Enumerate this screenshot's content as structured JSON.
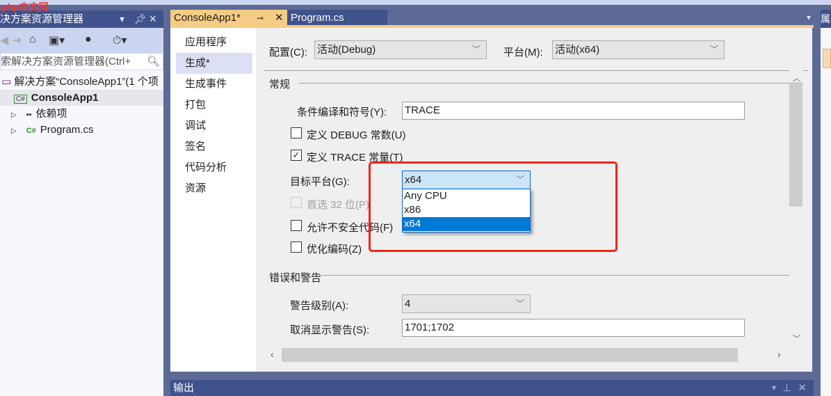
{
  "watermark": "php中文网",
  "solution_explorer": {
    "title": "决方案资源管理器",
    "search_placeholder": "索解决方案资源管理器(Ctrl+",
    "tree": [
      {
        "label": "解决方案“ConsoleApp1”(1 个项"
      },
      {
        "label": "ConsoleApp1",
        "badge": "C#"
      },
      {
        "label": "依赖项"
      },
      {
        "label": "Program.cs",
        "badge": "C#"
      }
    ]
  },
  "tabs": [
    {
      "label": "ConsoleApp1*"
    },
    {
      "label": "Program.cs"
    }
  ],
  "nav": [
    {
      "label": "应用程序"
    },
    {
      "label": "生成*"
    },
    {
      "label": "生成事件"
    },
    {
      "label": "打包"
    },
    {
      "label": "调试"
    },
    {
      "label": "签名"
    },
    {
      "label": "代码分析"
    },
    {
      "label": "资源"
    }
  ],
  "config": {
    "config_label": "配置(C):",
    "config_value": "活动(Debug)",
    "platform_label": "平台(M):",
    "platform_value": "活动(x64)"
  },
  "general": {
    "header": "常规",
    "symbols_label": "条件编译和符号(Y):",
    "symbols_value": "TRACE",
    "debug_const": "定义 DEBUG 常数(U)",
    "trace_const": "定义 TRACE 常量(T)",
    "target_label": "目标平台(G):",
    "target_value": "x64",
    "target_options": [
      "Any CPU",
      "x86",
      "x64"
    ],
    "prefer32": "首选 32 位(P)",
    "unsafe": "允许不安全代码(F)",
    "optimize": "优化编码(Z)"
  },
  "errors": {
    "header": "错误和警告",
    "level_label": "警告级别(A):",
    "level_value": "4",
    "suppress_label": "取消显示警告(S):",
    "suppress_value": "1701;1702"
  },
  "output": {
    "title": "输出"
  },
  "right_panel": {
    "title": "属"
  }
}
